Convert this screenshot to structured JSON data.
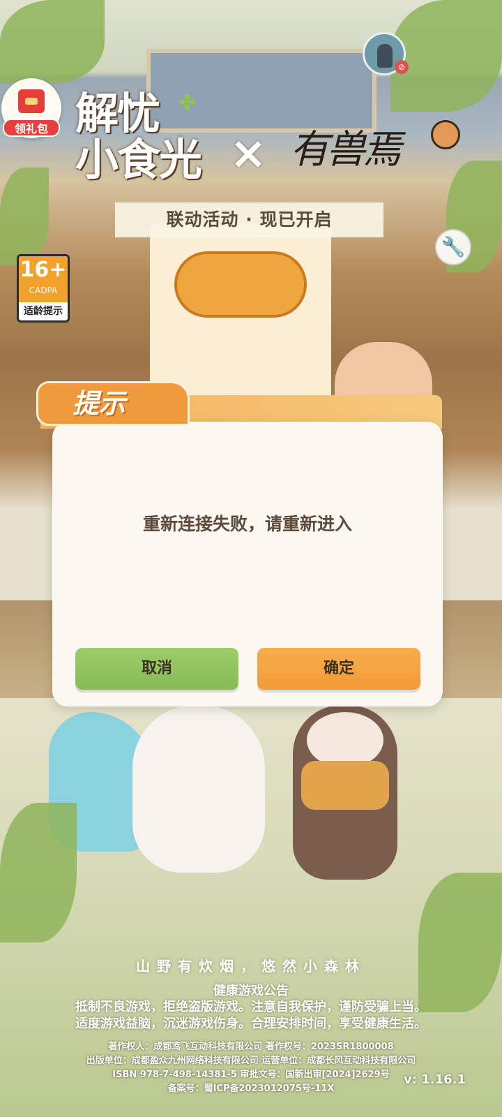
{
  "header": {
    "gift_label": "领礼包",
    "logo_left_line1": "解忧",
    "logo_left_line2": "小食光",
    "logo_cross": "×",
    "logo_right": "有兽焉",
    "event_banner": "联动活动 · 现已开启"
  },
  "age_rating": {
    "rating": "16+",
    "org": "CADPA",
    "tip": "适龄提示"
  },
  "dialog": {
    "title": "提示",
    "message": "重新连接失败，请重新进入",
    "cancel_label": "取消",
    "confirm_label": "确定"
  },
  "footer": {
    "slogan": "山野有炊烟，悠然小森林",
    "notice_title": "健康游戏公告",
    "notice_line1": "抵制不良游戏，拒绝盗版游戏。注意自我保护，谨防受骗上当。",
    "notice_line2": "适度游戏益脑，沉迷游戏伤身。合理安排时间，享受健康生活。",
    "copyright": "著作权人：成都鸢飞互动科技有限公司  著作权号：2023SR1800008",
    "publisher": "出版单位：成都盈众九州网络科技有限公司  运营单位：成都长风互动科技有限公司",
    "isbn": "ISBN 978-7-498-14381-5 审批文号：国新出审[2024]2629号",
    "icp": "备案号：蜀ICP备2023012075号-11X",
    "version": "v: 1.16.1"
  },
  "icons": {
    "gift": "gift-icon",
    "avatar": "user-avatar",
    "wrench": "wrench-icon"
  },
  "colors": {
    "confirm_button": "#f39a36",
    "cancel_button": "#86bb55",
    "dialog_header": "#f09a3e",
    "gift_red": "#e43d3a",
    "age_orange": "#f2a12d"
  }
}
